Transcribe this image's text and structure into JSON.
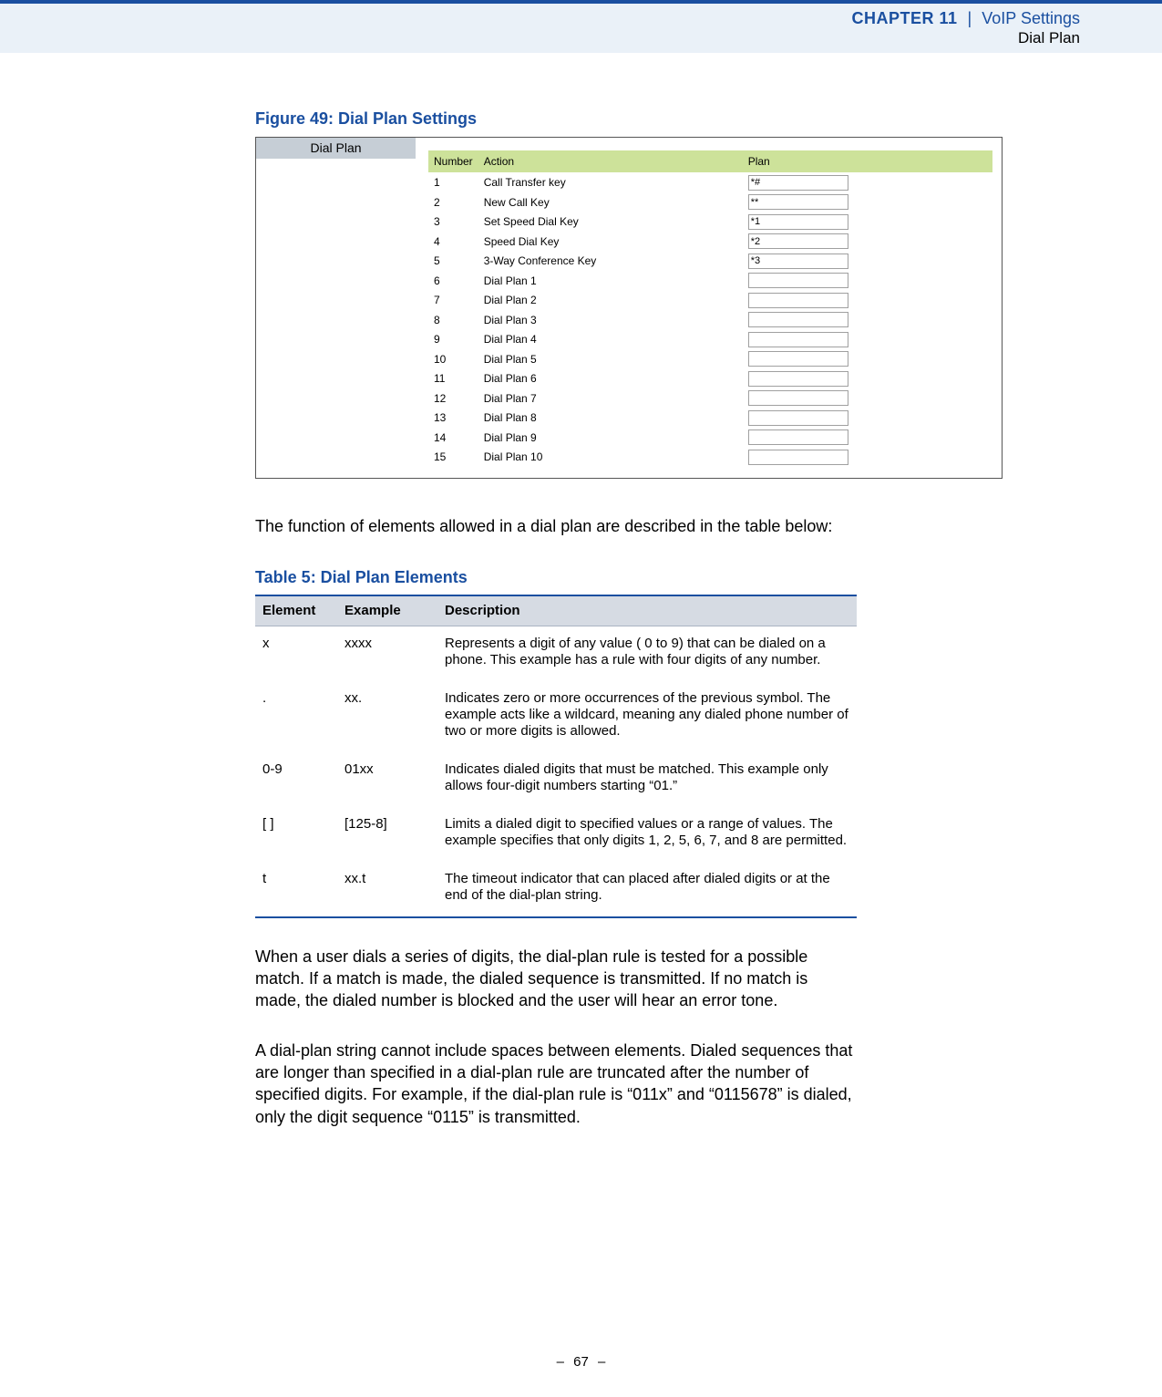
{
  "header": {
    "chapter_label": "CHAPTER 11",
    "section": "VoIP Settings",
    "subsection": "Dial Plan"
  },
  "figure": {
    "caption": "Figure 49:  Dial Plan Settings",
    "panel_title": "Dial Plan",
    "columns": {
      "number": "Number",
      "action": "Action",
      "plan": "Plan"
    },
    "rows": [
      {
        "number": "1",
        "action": "Call Transfer key",
        "plan": "*#"
      },
      {
        "number": "2",
        "action": "New Call Key",
        "plan": "**"
      },
      {
        "number": "3",
        "action": "Set Speed Dial Key",
        "plan": "*1"
      },
      {
        "number": "4",
        "action": "Speed Dial Key",
        "plan": "*2"
      },
      {
        "number": "5",
        "action": "3-Way Conference Key",
        "plan": "*3"
      },
      {
        "number": "6",
        "action": "Dial Plan 1",
        "plan": ""
      },
      {
        "number": "7",
        "action": "Dial Plan 2",
        "plan": ""
      },
      {
        "number": "8",
        "action": "Dial Plan 3",
        "plan": ""
      },
      {
        "number": "9",
        "action": "Dial Plan 4",
        "plan": ""
      },
      {
        "number": "10",
        "action": "Dial Plan 5",
        "plan": ""
      },
      {
        "number": "11",
        "action": "Dial Plan 6",
        "plan": ""
      },
      {
        "number": "12",
        "action": "Dial Plan 7",
        "plan": ""
      },
      {
        "number": "13",
        "action": "Dial Plan 8",
        "plan": ""
      },
      {
        "number": "14",
        "action": "Dial Plan 9",
        "plan": ""
      },
      {
        "number": "15",
        "action": "Dial Plan 10",
        "plan": ""
      }
    ]
  },
  "para1": "The function of elements allowed in a dial plan are described in the table below:",
  "table5": {
    "caption": "Table 5: Dial Plan Elements",
    "columns": {
      "element": "Element",
      "example": "Example",
      "description": "Description"
    },
    "rows": [
      {
        "element": "x",
        "example": "xxxx",
        "description": "Represents a digit of any value ( 0 to 9) that can be dialed on a phone. This example has a rule with four digits of any number."
      },
      {
        "element": ".",
        "example": "xx.",
        "description": "Indicates zero or more occurrences of the previous symbol. The example acts like a wildcard, meaning any dialed phone number of two or more digits is allowed."
      },
      {
        "element": "0-9",
        "example": "01xx",
        "description": "Indicates dialed digits that must be matched. This example only allows four-digit numbers starting “01.”"
      },
      {
        "element": "[  ]",
        "example": "[125-8]",
        "description": "Limits a dialed digit to specified values or a range of values. The example specifies that only digits 1, 2, 5, 6, 7, and 8 are permitted."
      },
      {
        "element": "t",
        "example": "xx.t",
        "description": "The timeout indicator that can placed after dialed digits or at the end of the dial-plan string."
      }
    ]
  },
  "para2": "When a user dials a series of digits, the dial-plan rule is tested for a possible match. If a match is made, the dialed sequence is transmitted. If no match is made, the dialed number is blocked and the user will hear an error tone.",
  "para3": "A dial-plan string cannot include spaces between elements. Dialed sequences that are longer than specified in a dial-plan rule are truncated after the number of specified digits. For example, if the dial-plan rule is “011x” and “0115678” is dialed, only the digit sequence “0115” is transmitted.",
  "footer": {
    "page": "67",
    "dash": "–"
  }
}
